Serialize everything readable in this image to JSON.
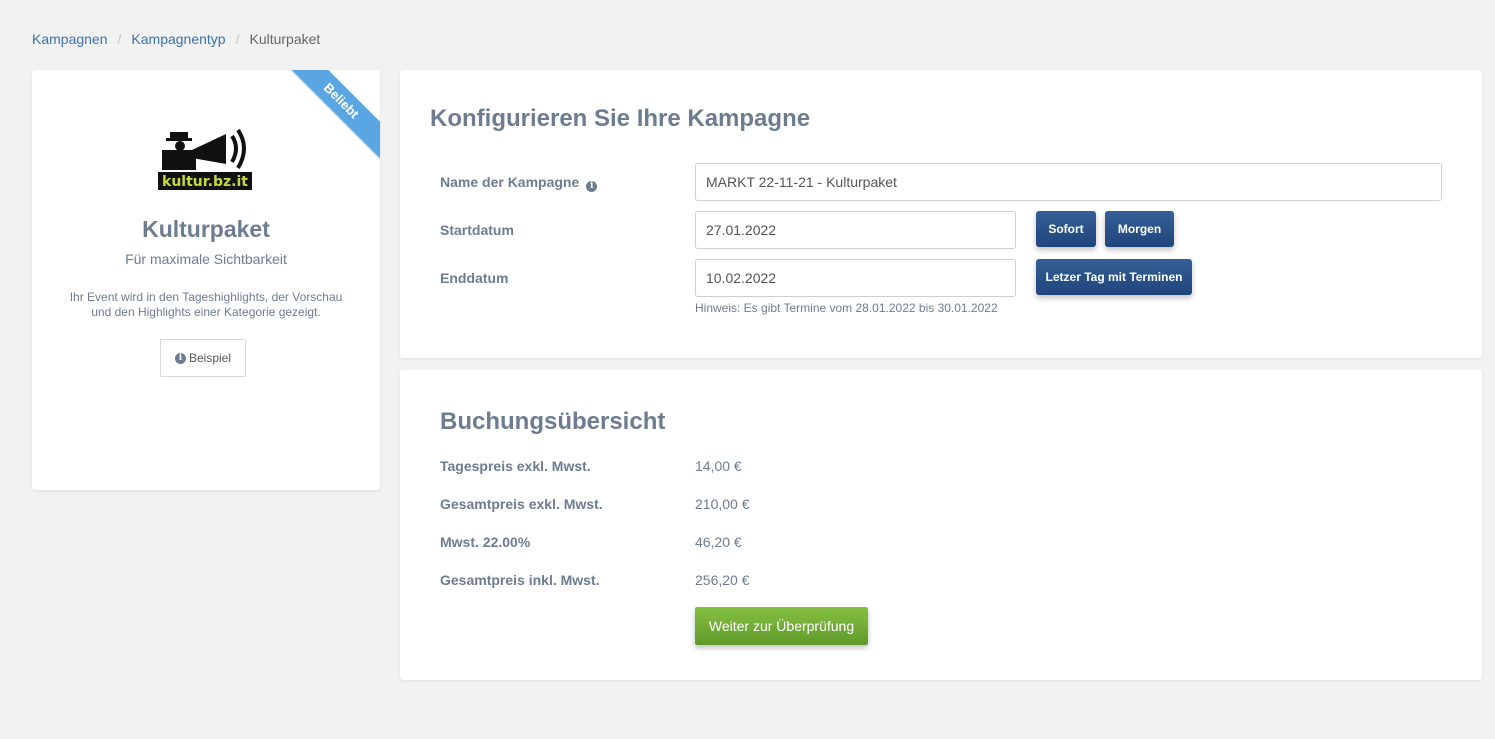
{
  "breadcrumb": {
    "items": [
      "Kampagnen",
      "Kampagnentyp"
    ],
    "current": "Kulturpaket"
  },
  "package": {
    "ribbon": "Beliebt",
    "logo_text": "kultur.bz.it",
    "title": "Kulturpaket",
    "subtitle": "Für maximale Sichtbarkeit",
    "description": "Ihr Event wird in den Tageshighlights, der Vorschau und den Highlights einer Kategorie gezeigt.",
    "example_button": "Beispiel"
  },
  "config": {
    "title": "Konfigurieren Sie Ihre Kampagne",
    "name_label": "Name der Kampagne",
    "name_value": "MARKT 22-11-21 - Kulturpaket",
    "start_label": "Startdatum",
    "start_value": "27.01.2022",
    "sofort_button": "Sofort",
    "morgen_button": "Morgen",
    "end_label": "Enddatum",
    "end_value": "10.02.2022",
    "last_day_button": "Letzer Tag mit Terminen",
    "hint": "Hinweis: Es gibt Termine vom 28.01.2022 bis 30.01.2022"
  },
  "summary": {
    "title": "Buchungsübersicht",
    "rows": [
      {
        "label": "Tagespreis exkl. Mwst.",
        "value": "14,00 €"
      },
      {
        "label": "Gesamtpreis exkl. Mwst.",
        "value": "210,00 €"
      },
      {
        "label": "Mwst. 22.00%",
        "value": "46,20 €"
      },
      {
        "label": "Gesamtpreis inkl. Mwst.",
        "value": "256,20 €"
      }
    ],
    "continue_button": "Weiter zur Überprüfung"
  },
  "colors": {
    "link": "#3a72ad",
    "ribbon": "#5aa6e2",
    "primary_dark": "#1f467d",
    "success": "#6fa935",
    "text_muted": "#6d7c91"
  }
}
